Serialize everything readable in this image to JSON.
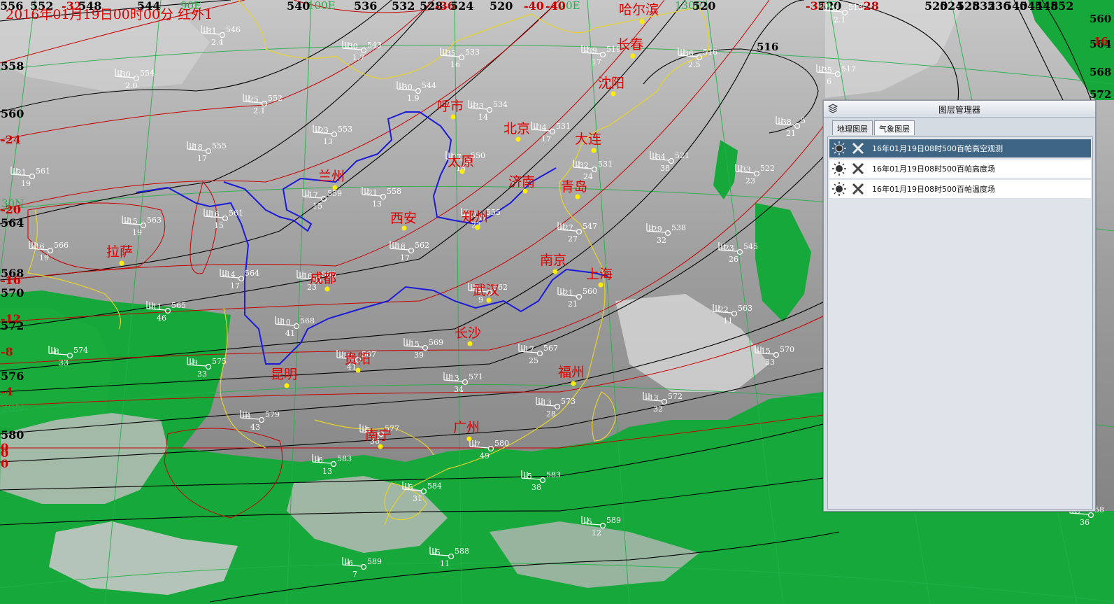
{
  "header": {
    "title": "2016年01月19日00时00分 红外1"
  },
  "colors": {
    "city": "#e00000",
    "height_line": "#000000",
    "temp_line": "#c80000",
    "grid": "#23b04a",
    "border": "#e6d22a",
    "river": "#1b1bd8",
    "land_green": "#16a33a",
    "station": "#ffffff"
  },
  "grid_labels": [
    {
      "text": "90E"
    },
    {
      "text": "100E"
    },
    {
      "text": "120E"
    },
    {
      "text": "130E"
    },
    {
      "text": "30N"
    },
    {
      "text": "20N"
    },
    {
      "text": "-10E"
    }
  ],
  "top_labels": [
    {
      "text": "556",
      "kind": "h"
    },
    {
      "text": "552",
      "kind": "h"
    },
    {
      "text": "-32",
      "kind": "t"
    },
    {
      "text": "548",
      "kind": "h"
    },
    {
      "text": "544",
      "kind": "h"
    },
    {
      "text": "540",
      "kind": "h"
    },
    {
      "text": "536",
      "kind": "h"
    },
    {
      "text": "532",
      "kind": "h"
    },
    {
      "text": "528",
      "kind": "h"
    },
    {
      "text": "-36",
      "kind": "t"
    },
    {
      "text": "524",
      "kind": "h"
    },
    {
      "text": "520",
      "kind": "h"
    },
    {
      "text": "-40",
      "kind": "t"
    },
    {
      "text": "-40",
      "kind": "t"
    },
    {
      "text": "520",
      "kind": "h"
    },
    {
      "text": "-32",
      "kind": "t"
    },
    {
      "text": "520",
      "kind": "h"
    },
    {
      "text": "-28",
      "kind": "t"
    },
    {
      "text": "520",
      "kind": "h"
    },
    {
      "text": "524",
      "kind": "h"
    },
    {
      "text": "528",
      "kind": "h"
    },
    {
      "text": "532",
      "kind": "h"
    },
    {
      "text": "536",
      "kind": "h"
    },
    {
      "text": "540",
      "kind": "h"
    },
    {
      "text": "544",
      "kind": "h"
    },
    {
      "text": "548",
      "kind": "h"
    },
    {
      "text": "552",
      "kind": "h"
    }
  ],
  "left_labels": [
    {
      "text": "558",
      "kind": "h"
    },
    {
      "text": "560",
      "kind": "h"
    },
    {
      "text": "-24",
      "kind": "t"
    },
    {
      "text": "-20",
      "kind": "t"
    },
    {
      "text": "564",
      "kind": "h"
    },
    {
      "text": "568",
      "kind": "h"
    },
    {
      "text": "-16",
      "kind": "t"
    },
    {
      "text": "570",
      "kind": "h"
    },
    {
      "text": "-12",
      "kind": "t"
    },
    {
      "text": "572",
      "kind": "h"
    },
    {
      "text": "-8",
      "kind": "t"
    },
    {
      "text": "576",
      "kind": "h"
    },
    {
      "text": "-4",
      "kind": "t"
    },
    {
      "text": "580",
      "kind": "h"
    },
    {
      "text": "0",
      "kind": "t"
    },
    {
      "text": "0",
      "kind": "t"
    },
    {
      "text": "0",
      "kind": "t"
    }
  ],
  "right_labels": [
    {
      "text": "560",
      "kind": "h"
    },
    {
      "text": "564",
      "kind": "h"
    },
    {
      "text": "568",
      "kind": "h"
    },
    {
      "text": "572",
      "kind": "h"
    },
    {
      "text": "16",
      "kind": "t"
    },
    {
      "text": "516",
      "kind": "h"
    }
  ],
  "cities": [
    {
      "name": "哈尔滨"
    },
    {
      "name": "长春"
    },
    {
      "name": "沈阳"
    },
    {
      "name": "呼市"
    },
    {
      "name": "北京"
    },
    {
      "name": "大连"
    },
    {
      "name": "太原"
    },
    {
      "name": "济南"
    },
    {
      "name": "青岛"
    },
    {
      "name": "兰州"
    },
    {
      "name": "西安"
    },
    {
      "name": "郑州"
    },
    {
      "name": "拉萨"
    },
    {
      "name": "成都"
    },
    {
      "name": "南京"
    },
    {
      "name": "上海"
    },
    {
      "name": "武汉"
    },
    {
      "name": "长沙"
    },
    {
      "name": "昆明"
    },
    {
      "name": "贵阳"
    },
    {
      "name": "福州"
    },
    {
      "name": "南宁"
    },
    {
      "name": "广州"
    }
  ],
  "stations": [
    {
      "temp": "-31",
      "height": "546",
      "dewp": "2.4"
    },
    {
      "temp": "-30",
      "height": "543",
      "dewp": "1.7"
    },
    {
      "temp": "-35",
      "height": "533",
      "dewp": "16"
    },
    {
      "temp": "-39",
      "height": "519",
      "dewp": "17"
    },
    {
      "temp": "-36",
      "height": "516",
      "dewp": "2.5"
    },
    {
      "temp": "-35",
      "height": "517",
      "dewp": "6"
    },
    {
      "temp": "-30",
      "height": "554",
      "dewp": "2.0"
    },
    {
      "temp": "-30",
      "height": "544",
      "dewp": "1.9"
    },
    {
      "temp": "-33",
      "height": "534",
      "dewp": "14"
    },
    {
      "temp": "-34",
      "height": "531",
      "dewp": "17"
    },
    {
      "temp": "-38",
      "height": "5",
      "dewp": "21"
    },
    {
      "temp": "-25",
      "height": "552",
      "dewp": "2.1"
    },
    {
      "temp": "-23",
      "height": "553",
      "dewp": "13"
    },
    {
      "temp": "-18",
      "height": "555",
      "dewp": "17"
    },
    {
      "temp": "-27",
      "height": "550",
      "dewp": "18"
    },
    {
      "temp": "-32",
      "height": "531",
      "dewp": "24"
    },
    {
      "temp": "-34",
      "height": "521",
      "dewp": "38"
    },
    {
      "temp": "-33",
      "height": "522",
      "dewp": "23"
    },
    {
      "temp": "-21",
      "height": "561",
      "dewp": "19"
    },
    {
      "temp": "-17",
      "height": "559",
      "dewp": "15"
    },
    {
      "temp": "-21",
      "height": "558",
      "dewp": "13"
    },
    {
      "temp": "-16",
      "height": "561",
      "dewp": "15"
    },
    {
      "temp": "-15",
      "height": "563",
      "dewp": "19"
    },
    {
      "temp": "-25",
      "height": "555",
      "dewp": "22"
    },
    {
      "temp": "-27",
      "height": "547",
      "dewp": "27"
    },
    {
      "temp": "-29",
      "height": "538",
      "dewp": "32"
    },
    {
      "temp": "-16",
      "height": "566",
      "dewp": "19"
    },
    {
      "temp": "-18",
      "height": "562",
      "dewp": "17"
    },
    {
      "temp": "-23",
      "height": "545",
      "dewp": "26"
    },
    {
      "temp": "-14",
      "height": "564",
      "dewp": "17"
    },
    {
      "temp": "-16",
      "height": "563",
      "dewp": "23"
    },
    {
      "temp": "-30",
      "height": "562",
      "dewp": "9"
    },
    {
      "temp": "-21",
      "height": "560",
      "dewp": "21"
    },
    {
      "temp": "-11",
      "height": "565",
      "dewp": "46"
    },
    {
      "temp": "-10",
      "height": "568",
      "dewp": "41"
    },
    {
      "temp": "-22",
      "height": "563",
      "dewp": "11"
    },
    {
      "temp": "-8",
      "height": "574",
      "dewp": "33"
    },
    {
      "temp": "-9",
      "height": "575",
      "dewp": "33"
    },
    {
      "temp": "-10",
      "height": "567",
      "dewp": "41"
    },
    {
      "temp": "-15",
      "height": "569",
      "dewp": "39"
    },
    {
      "temp": "-17",
      "height": "567",
      "dewp": "25"
    },
    {
      "temp": "-15",
      "height": "570",
      "dewp": "33"
    },
    {
      "temp": "-13",
      "height": "571",
      "dewp": "34"
    },
    {
      "temp": "-13",
      "height": "573",
      "dewp": "28"
    },
    {
      "temp": "-13",
      "height": "572",
      "dewp": "32"
    },
    {
      "temp": "-4",
      "height": "579",
      "dewp": "43"
    },
    {
      "temp": "-5",
      "height": "577",
      "dewp": "36"
    },
    {
      "temp": "-7",
      "height": "580",
      "dewp": "49"
    },
    {
      "temp": "-6",
      "height": "583",
      "dewp": "13"
    },
    {
      "temp": "-5",
      "height": "583",
      "dewp": "38"
    },
    {
      "temp": "-5",
      "height": "584",
      "dewp": "31"
    },
    {
      "temp": "-5",
      "height": "589",
      "dewp": "12"
    },
    {
      "temp": "-6",
      "height": "589",
      "dewp": "7"
    },
    {
      "temp": "-5",
      "height": "588",
      "dewp": "11"
    },
    {
      "temp": "-5",
      "height": "58",
      "dewp": "36"
    },
    {
      "temp": "-31",
      "height": "513",
      "dewp": "2.1"
    }
  ],
  "layer_panel": {
    "title": "图层管理器",
    "tabs": [
      {
        "label": "地理图层"
      },
      {
        "label": "气象图层"
      }
    ],
    "active_tab": "气象图层",
    "layers": [
      {
        "name": "16年01月19日08时500百帕高空观测",
        "selected": true
      },
      {
        "name": "16年01月19日08时500百帕高度场",
        "selected": false
      },
      {
        "name": "16年01月19日08时500百帕温度场",
        "selected": false
      }
    ]
  }
}
